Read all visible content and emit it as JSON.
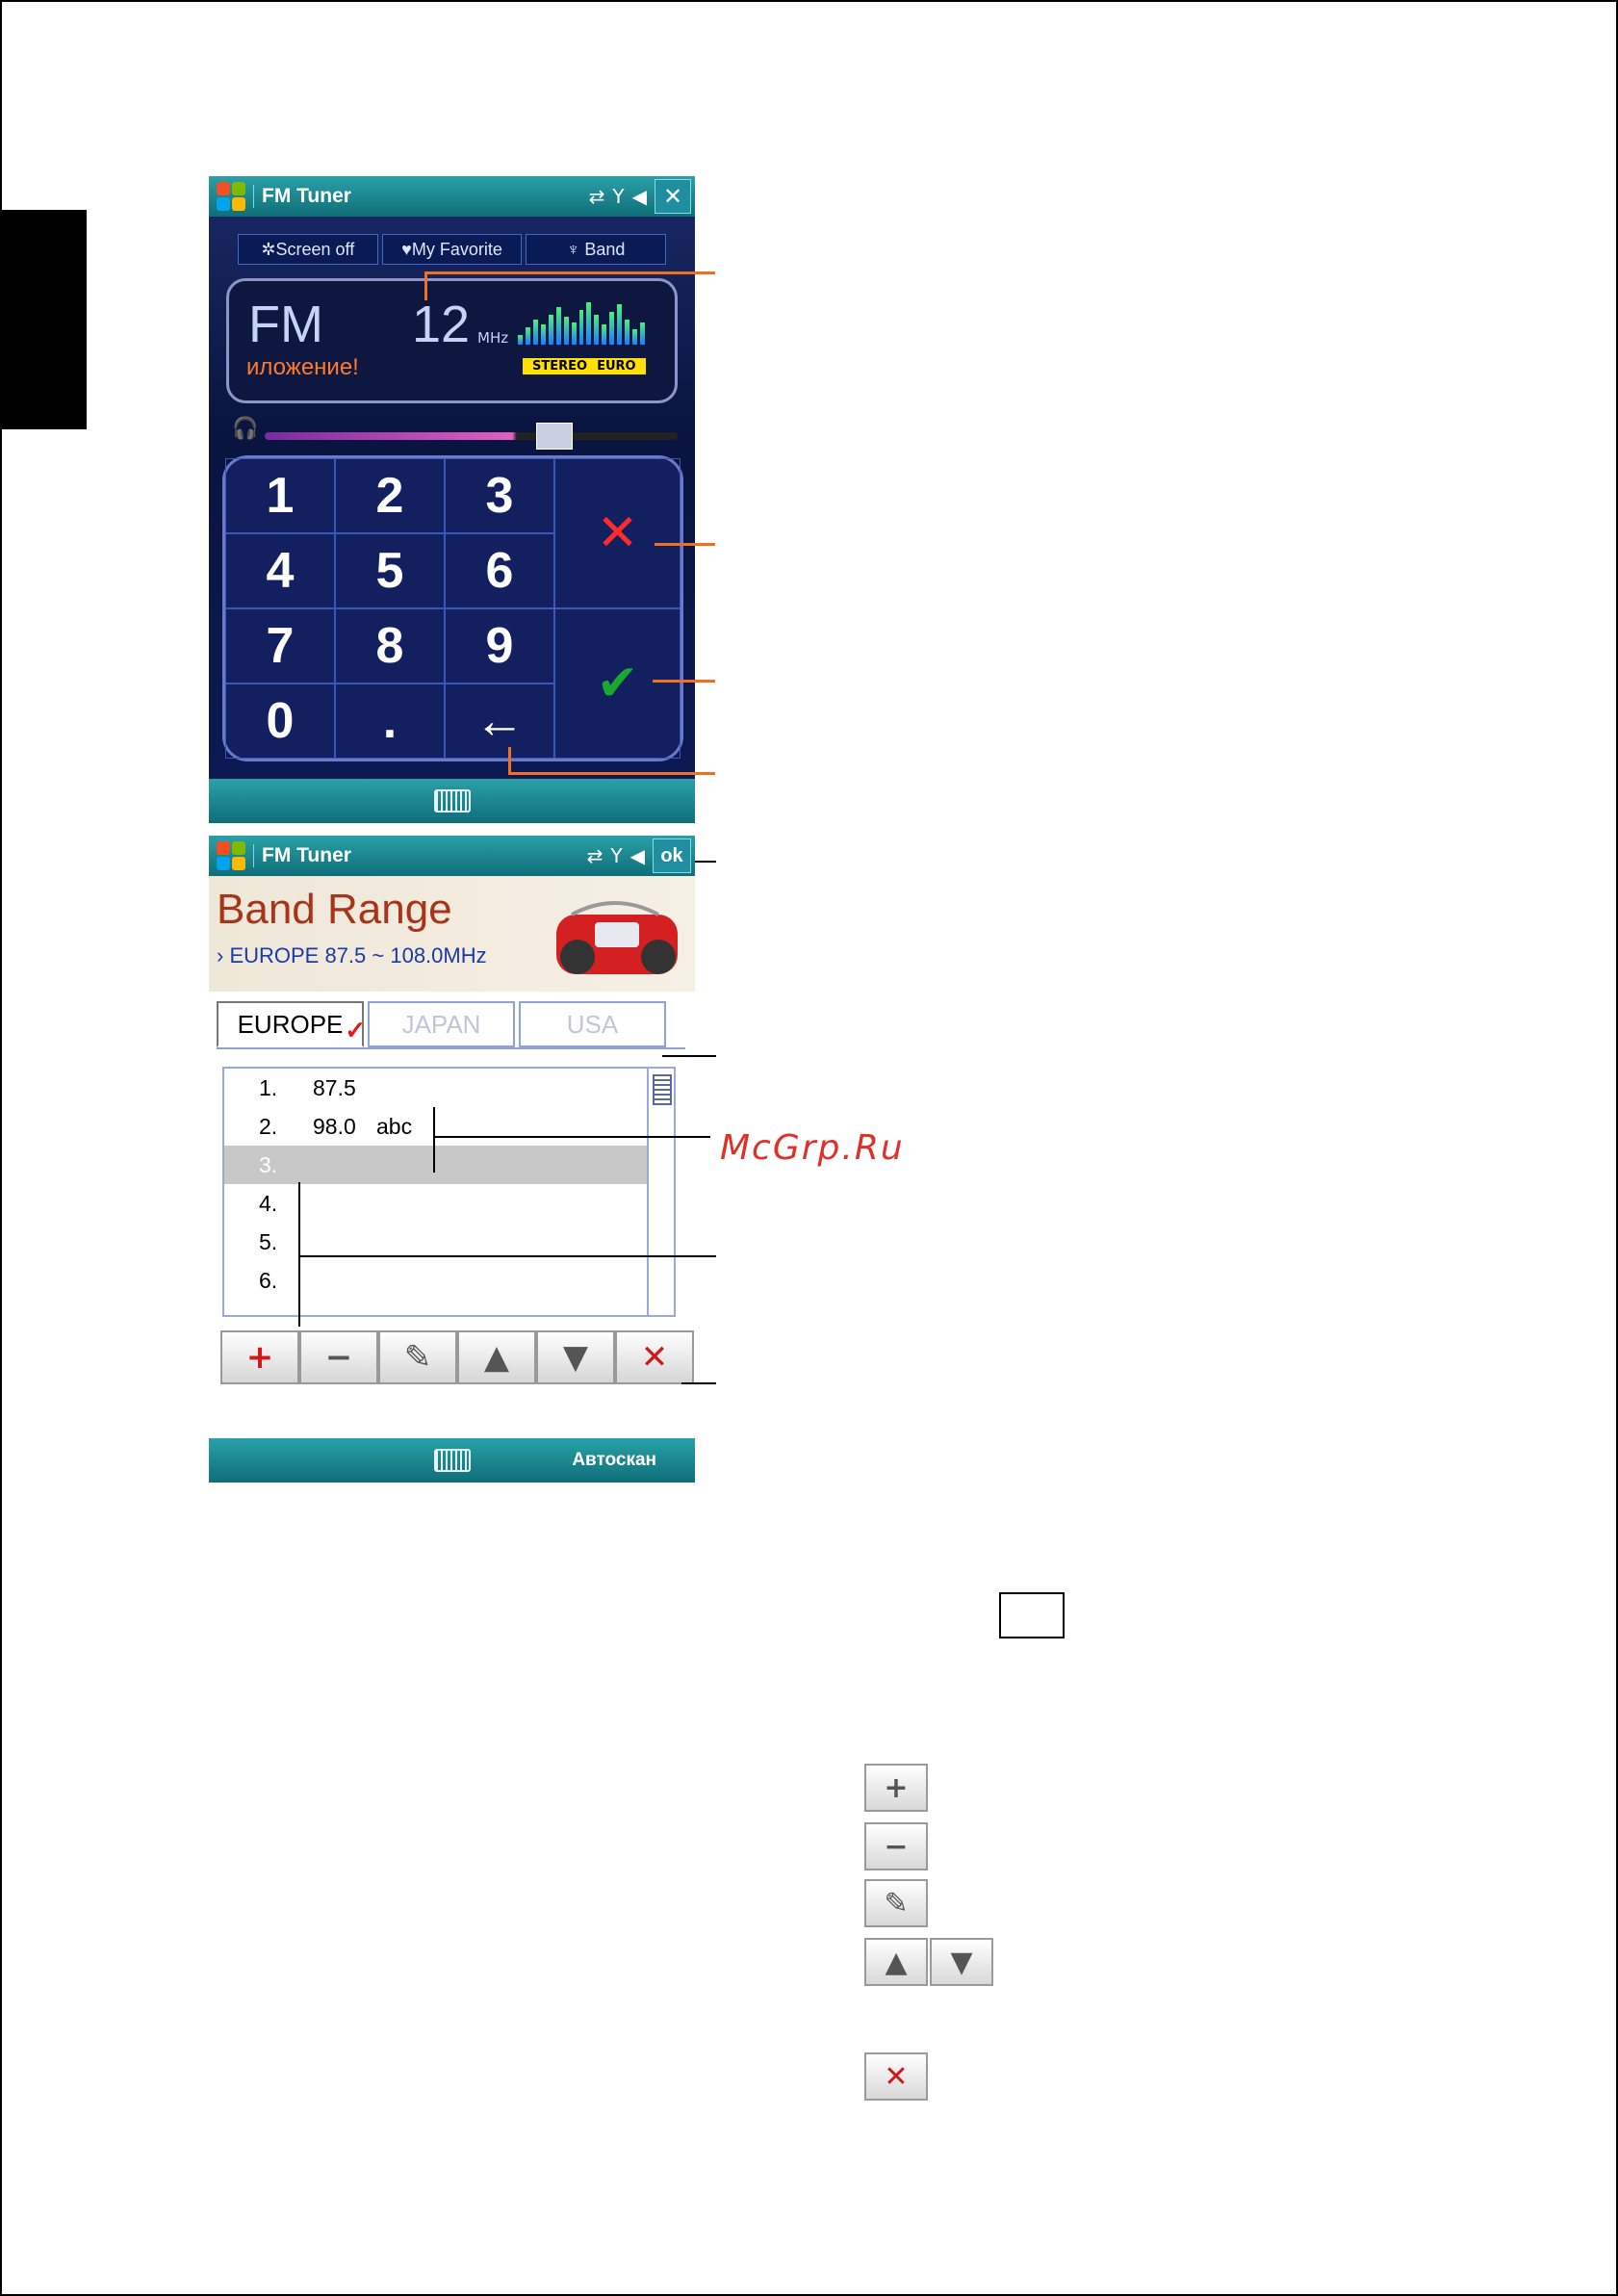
{
  "screen1": {
    "app_title": "FM Tuner",
    "tabs": [
      "✲Screen off",
      "♥My Favorite",
      "♆ Band"
    ],
    "band_label": "FM",
    "frequency": "12",
    "unit": "MHz",
    "rds_text": "иложение!",
    "stereo_label": "STEREO",
    "region_label": "EURO",
    "keys": [
      "1",
      "2",
      "3",
      "4",
      "5",
      "6",
      "7",
      "8",
      "9",
      "0",
      "."
    ]
  },
  "screen2": {
    "app_title": "FM Tuner",
    "ok_label": "ok",
    "header": "Band Range",
    "range_text": "› EUROPE 87.5 ~ 108.0MHz",
    "tabs": [
      "EUROPE",
      "JAPAN",
      "USA"
    ],
    "list": [
      {
        "num": "1.",
        "freq": "87.5",
        "name": ""
      },
      {
        "num": "2.",
        "freq": "98.0",
        "name": "abc"
      },
      {
        "num": "3.",
        "freq": "",
        "name": ""
      },
      {
        "num": "4.",
        "freq": "",
        "name": ""
      },
      {
        "num": "5.",
        "freq": "",
        "name": ""
      },
      {
        "num": "6.",
        "freq": "",
        "name": ""
      }
    ],
    "softkey": "Автоскан"
  },
  "watermark": "McGrp.Ru",
  "colors": {
    "callout": "#f07020",
    "accent_teal": "#1f8ea0",
    "delete_red": "#e01818",
    "confirm_green": "#1aa830"
  }
}
